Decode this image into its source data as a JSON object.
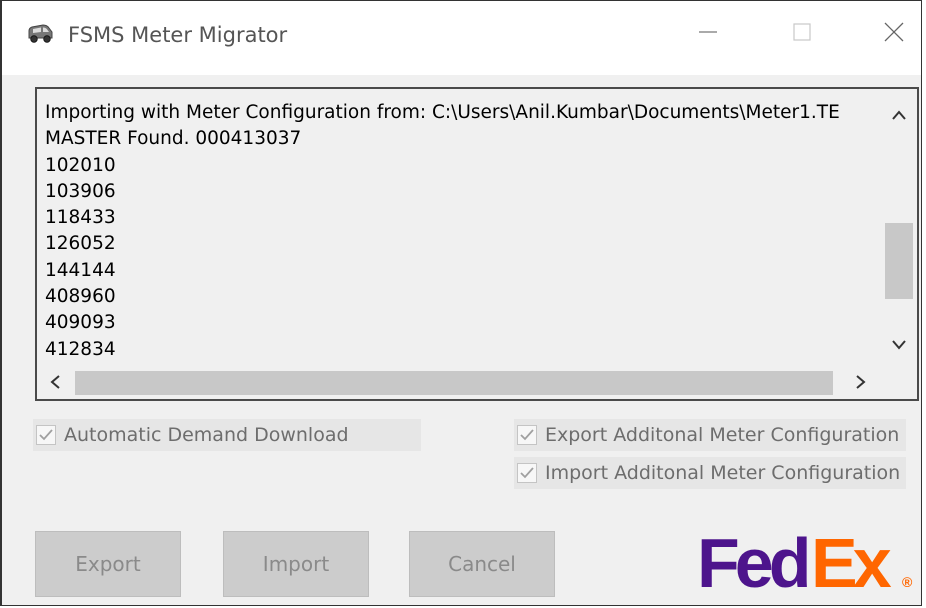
{
  "window": {
    "title": "FSMS Meter Migrator",
    "icon": "truck-icon",
    "controls": [
      "minimize-icon",
      "maximize-icon",
      "close-icon"
    ]
  },
  "log": {
    "lines": [
      "Importing with Meter Configuration from: C:\\Users\\Anil.Kumbar\\Documents\\Meter1.TE",
      "MASTER Found. 000413037",
      "102010",
      "103906",
      "118433",
      "126052",
      "144144",
      "408960",
      "409093",
      "412834"
    ]
  },
  "options": {
    "auto_demand_download": {
      "label": "Automatic Demand Download",
      "checked": true,
      "enabled": false
    },
    "export_additional": {
      "label": "Export Additonal Meter Configuration",
      "checked": true,
      "enabled": false
    },
    "import_additional": {
      "label": "Import Additonal Meter Configuration",
      "checked": true,
      "enabled": false
    }
  },
  "buttons": {
    "export": "Export",
    "import": "Import",
    "cancel": "Cancel"
  },
  "logo": {
    "part1": "Fed",
    "part2": "Ex",
    "mark": "®",
    "color_purple": "#4d148c",
    "color_orange": "#ff6600"
  }
}
